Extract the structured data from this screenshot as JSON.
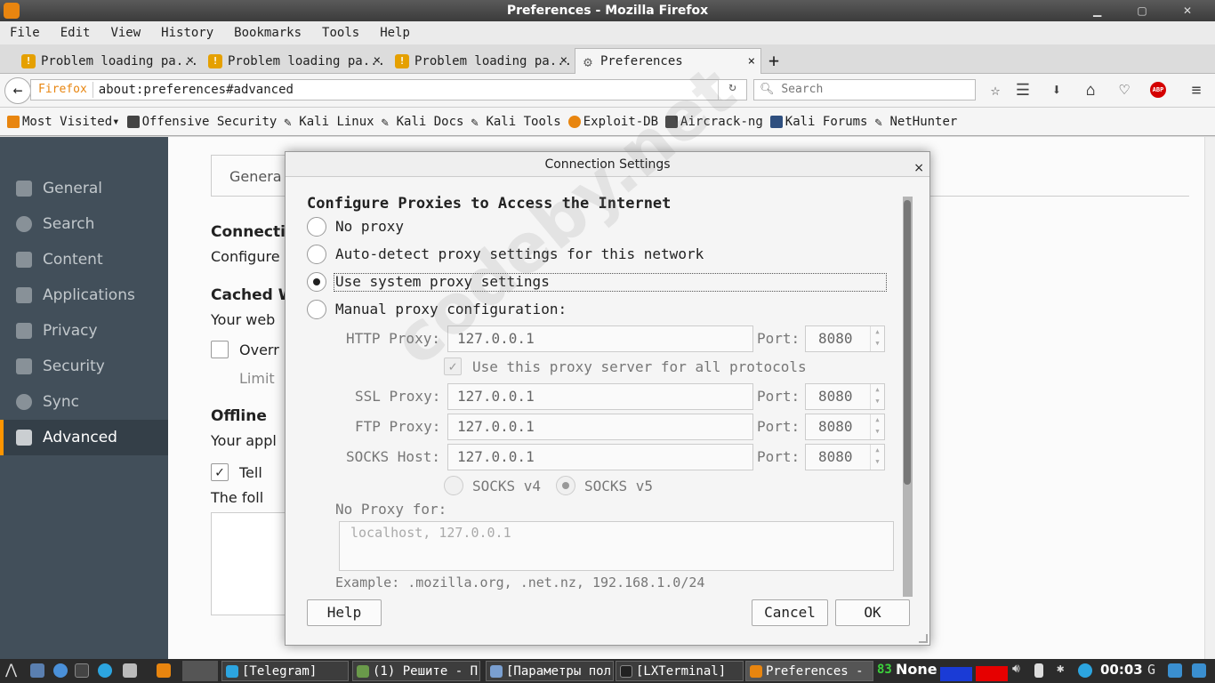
{
  "window": {
    "title": "Preferences - Mozilla Firefox"
  },
  "menubar": {
    "items": [
      "File",
      "Edit",
      "View",
      "History",
      "Bookmarks",
      "Tools",
      "Help"
    ]
  },
  "tabs": [
    {
      "label": "Problem loading pa..."
    },
    {
      "label": "Problem loading pa..."
    },
    {
      "label": "Problem loading pa..."
    },
    {
      "label": "Preferences"
    }
  ],
  "tab_close": "×",
  "new_tab": "+",
  "navbar": {
    "identity": "Firefox",
    "url": "about:preferences#advanced",
    "search_placeholder": "Search"
  },
  "abp_label": "ABP",
  "bookmarks": [
    "Most Visited▾",
    "Offensive Security",
    "Kali Linux",
    "Kali Docs",
    "Kali Tools",
    "Exploit-DB",
    "Aircrack-ng",
    "Kali Forums",
    "NetHunter"
  ],
  "sidebar": {
    "items": [
      "General",
      "Search",
      "Content",
      "Applications",
      "Privacy",
      "Security",
      "Sync",
      "Advanced"
    ],
    "active": "Advanced"
  },
  "content": {
    "tab_general": "Genera",
    "connection_heading": "Connecti",
    "connection_desc": "Configure",
    "cached_heading": "Cached W",
    "cached_desc": "Your web",
    "override_label": "Overr",
    "limit_label": "Limit",
    "offline_heading": "Offline",
    "offline_desc": "Your appl",
    "tell_label": "Tell",
    "following_desc": "The foll"
  },
  "dialog": {
    "title": "Connection Settings",
    "close": "×",
    "heading": "Configure Proxies to Access the Internet",
    "options": {
      "no_proxy": "No proxy",
      "auto_detect": "Auto-detect proxy settings for this network",
      "system": "Use system proxy settings",
      "manual": "Manual proxy configuration:"
    },
    "selected_option": "system",
    "http_label": "HTTP Proxy:",
    "http_value": "127.0.0.1",
    "port_label": "Port:",
    "http_port": "8080",
    "use_all_label": "Use this proxy server for all protocols",
    "ssl_label": "SSL Proxy:",
    "ssl_value": "127.0.0.1",
    "ssl_port": "8080",
    "ftp_label": "FTP Proxy:",
    "ftp_value": "127.0.0.1",
    "ftp_port": "8080",
    "socks_label": "SOCKS Host:",
    "socks_value": "127.0.0.1",
    "socks_port": "8080",
    "socks_v4": "SOCKS v4",
    "socks_v5": "SOCKS v5",
    "no_proxy_for_label": "No Proxy for:",
    "no_proxy_for_value": "localhost, 127.0.0.1",
    "example": "Example: .mozilla.org, .net.nz, 192.168.1.0/24",
    "buttons": {
      "help": "Help",
      "cancel": "Cancel",
      "ok": "OK"
    }
  },
  "watermark": "codeby.net",
  "taskbar": {
    "tasks": [
      "[Telegram]",
      "(1) Решите - П...",
      "[Параметры пол...",
      "[LXTerminal]",
      "Preferences - ..."
    ],
    "battery": "83",
    "status": "None",
    "clock": "00:03"
  },
  "colors": {
    "sidebar_bg": "#424f5a",
    "sidebar_active_bg": "#343f48",
    "accent": "#ff9500",
    "taskbar_bg": "#2b2b2b"
  }
}
